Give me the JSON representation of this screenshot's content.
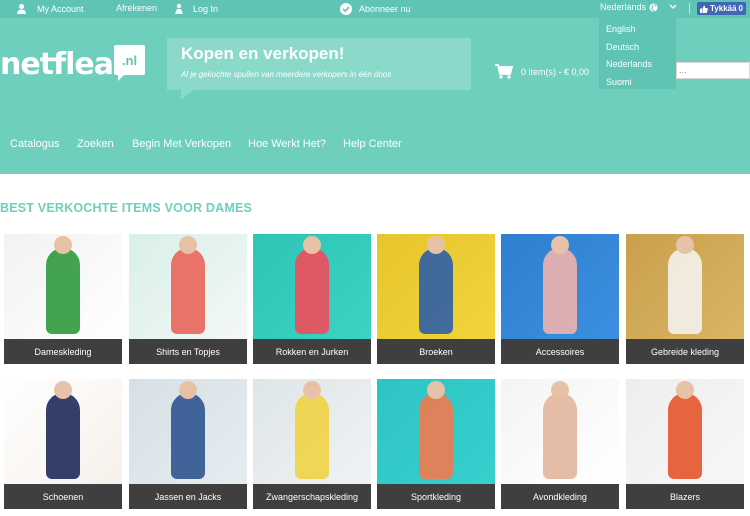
{
  "topbar": {
    "my_account": "My Account",
    "checkout": "Afrekenen",
    "login": "Log In",
    "subscribe": "Abonneer nu",
    "language": "Nederlands",
    "like": "Tykkää",
    "like_count": "0"
  },
  "header": {
    "logo_text": "netflea",
    "logo_badge": ".nl",
    "slogan_title": "Kopen en verkopen!",
    "slogan_sub": "Al je gekochte spullen van meerdere verkopers in één doos",
    "cart_text": "0 item(s) - € 0,00",
    "search_stub": "..."
  },
  "languages": [
    "English",
    "Deutsch",
    "Nederlands",
    "Suomi"
  ],
  "nav": [
    "Catalogus",
    "Zoeken",
    "Begin Met Verkopen",
    "Hoe Werkt Het?",
    "Help Center"
  ],
  "section_title": "BEST VERKOCHTE ITEMS VOOR DAMES",
  "categories": [
    {
      "label": "Dameskleding",
      "colors": [
        "#f2f2f2",
        "#ffffff",
        "#2e9a3b"
      ]
    },
    {
      "label": "Shirts en Topjes",
      "colors": [
        "#d9efe9",
        "#f3f8f6",
        "#e9655a"
      ]
    },
    {
      "label": "Rokken en Jurken",
      "colors": [
        "#2fc4b6",
        "#3bd3c3",
        "#ef4b5b"
      ]
    },
    {
      "label": "Broeken",
      "colors": [
        "#e7c52c",
        "#f1d43d",
        "#2e5fa6"
      ]
    },
    {
      "label": "Accessoires",
      "colors": [
        "#2f7fd0",
        "#3c8fe0",
        "#eeb3ad"
      ]
    },
    {
      "label": "Gebreide kleding",
      "colors": [
        "#c9a04d",
        "#d9b565",
        "#f4f1ec"
      ]
    },
    {
      "label": "Schoenen",
      "colors": [
        "#ffffff",
        "#f6f0ea",
        "#1e2a5a"
      ]
    },
    {
      "label": "Jassen en Jacks",
      "colors": [
        "#d7e0e6",
        "#e6edf1",
        "#2f5590"
      ]
    },
    {
      "label": "Zwangerschapskleding",
      "colors": [
        "#dfe6e8",
        "#eef2f3",
        "#f1d344"
      ]
    },
    {
      "label": "Sportkleding",
      "colors": [
        "#2fc4c4",
        "#36d0cd",
        "#f07a4e"
      ]
    },
    {
      "label": "Avondkleding",
      "colors": [
        "#f4f4f4",
        "#ffffff",
        "#e2b69c"
      ]
    },
    {
      "label": "Blazers",
      "colors": [
        "#eeeeee",
        "#f7f7f7",
        "#e4552a"
      ]
    }
  ]
}
